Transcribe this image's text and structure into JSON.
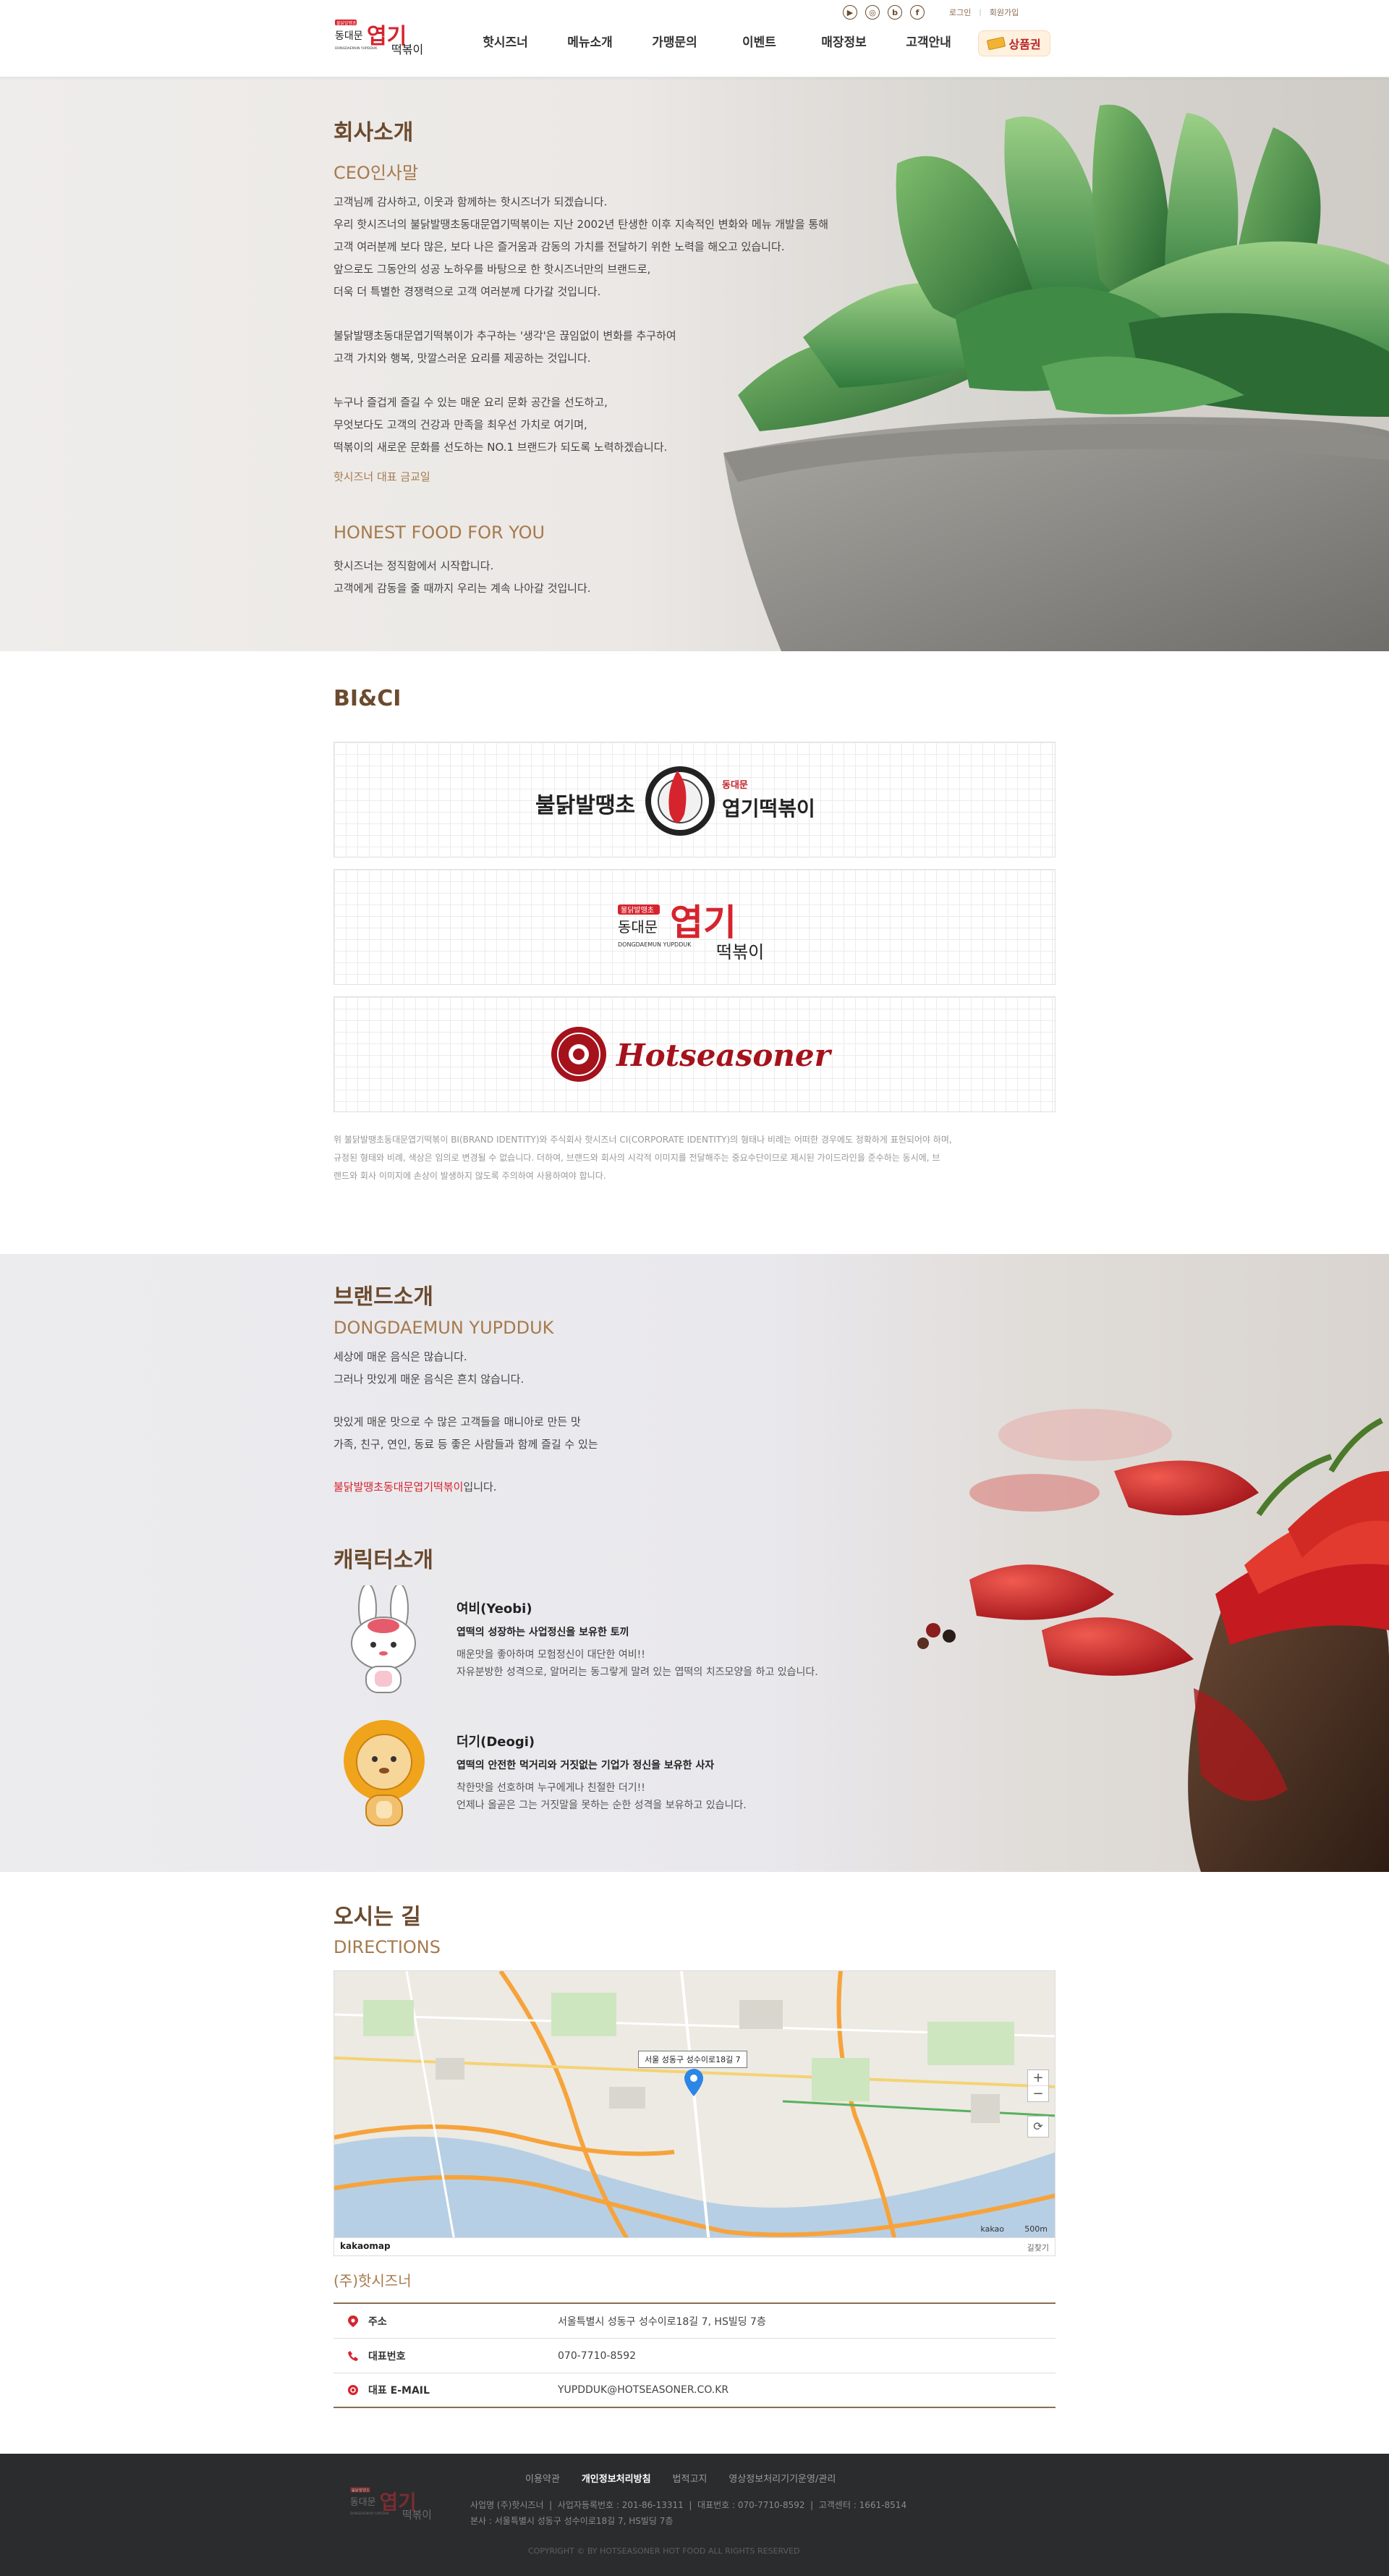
{
  "header": {
    "logo_small": "불닭발땡초",
    "logo_line1": "동대문",
    "logo_big": "엽기",
    "logo_line2": "떡볶이",
    "logo_en": "DONGDAEMUN YUPDDUK",
    "login": "로그인",
    "sep": "|",
    "join": "회원가입",
    "nav": [
      "핫시즈너",
      "메뉴소개",
      "가맹문의",
      "이벤트",
      "매장정보",
      "고객안내"
    ],
    "voucher": "상품권"
  },
  "company": {
    "title": "회사소개",
    "ceo_title": "CEO인사말",
    "paragraph1": [
      "고객님께 감사하고, 이웃과 함께하는 핫시즈너가 되겠습니다.",
      "우리 핫시즈너의 불닭발땡초동대문엽기떡볶이는 지난 2002년 탄생한 이후 지속적인 변화와 메뉴 개발을 통해",
      "고객 여러분께 보다 많은, 보다 나은 즐거움과 감동의 가치를 전달하기 위한 노력을 해오고 있습니다.",
      "앞으로도 그동안의 성공 노하우를 바탕으로 한 핫시즈너만의 브랜드로,",
      "더욱 더 특별한 경쟁력으로 고객 여러분께 다가갈 것입니다."
    ],
    "paragraph2": [
      "불닭발땡초동대문엽기떡볶이가 추구하는 '생각'은 끊임없이 변화를 추구하여",
      "고객 가치와 행복, 맛깔스러운 요리를 제공하는 것입니다."
    ],
    "paragraph3": [
      "누구나 즐겁게 즐길 수 있는 매운 요리 문화 공간을 선도하고,",
      "무엇보다도 고객의 건강과 만족을 최우선 가치로 여기며,",
      "떡볶이의 새로운 문화를 선도하는 NO.1 브랜드가 되도록 노력하겠습니다."
    ],
    "signature": "핫시즈너 대표 금교일",
    "honest_title": "HONEST FOOD FOR YOU",
    "honest_lines": [
      "핫시즈너는 정직함에서 시작합니다.",
      "고객에게 감동을 줄 때까지 우리는 계속 나아갈 것입니다."
    ]
  },
  "bi": {
    "title": "BI&CI",
    "logo1_left": "불닭발땡초",
    "logo1_right_small": "동대문",
    "logo1_right": "엽기떡볶이",
    "logo2_small": "불닭발땡초",
    "logo2_line1": "동대문",
    "logo2_big": "엽기",
    "logo2_line2": "떡볶이",
    "logo2_en": "DONGDAEMUN YUPDDUK",
    "logo3_text": "Hotseasoner",
    "note": [
      "위 불닭발땡초동대문엽기떡볶이 BI(BRAND IDENTITY)와 주식회사 핫시즈너 CI(CORPORATE IDENTITY)의 형태나 비례는 어떠한 경우에도 정확하게 표현되어야 하며,",
      "규정된 형태와 비례, 색상은 임의로 변경될 수 없습니다. 더하여, 브랜드와 회사의 시각적 이미지를 전달해주는 중요수단이므로 제시된 가이드라인을 준수하는 동시에, 브",
      "랜드와 회사 이미지에 손상이 발생하지 않도록 주의하여 사용하여야 합니다."
    ]
  },
  "brand": {
    "title": "브랜드소개",
    "sub": "DONGDAEMUN YUPDDUK",
    "lines1": [
      "세상에 매운 음식은 많습니다.",
      "그러나 맛있게 매운 음식은 흔치 않습니다."
    ],
    "lines2": [
      "맛있게 매운 맛으로 수 많은 고객들을 매니아로 만든 맛",
      "가족, 친구, 연인, 동료 등 좋은 사람들과 함께 즐길 수 있는"
    ],
    "highlight": "불닭발땡초동대문엽기떡볶이",
    "tail": "입니다.",
    "char_title": "캐릭터소개",
    "characters": [
      {
        "name": "여비(Yeobi)",
        "desc": "엽떡의 성장하는 사업정신을 보유한 토끼",
        "lines": [
          "매운맛을 좋아하며 모험정신이 대단한 여비!!",
          "자유분방한 성격으로, 알머리는 동그랗게 말려 있는 엽떡의 치즈모양을 하고 있습니다."
        ]
      },
      {
        "name": "더기(Deogi)",
        "desc": "엽떡의 안전한 먹거리와 거짓없는 기업가 정신을 보유한 사자",
        "lines": [
          "착한맛을 선호하며 누구에게나 친절한 더기!!",
          "언제나 올곧은 그는 거짓말을 못하는 순한 성격을 보유하고 있습니다."
        ]
      }
    ]
  },
  "directions": {
    "title": "오시는 길",
    "sub": "DIRECTIONS",
    "map_label": "서울 성동구 성수이로18길 7",
    "map_brand": "kakaomap",
    "map_scale": "500m",
    "map_brand_small": "kakao",
    "map_link": "길찾기",
    "company": "(주)핫시즈너",
    "rows": [
      {
        "label": "주소",
        "value": "서울특별시 성동구 성수이로18길 7, HS빌딩 7층"
      },
      {
        "label": "대표번호",
        "value": "070-7710-8592"
      },
      {
        "label": "대표 E-MAIL",
        "value": "YUPDDUK@HOTSEASONER.CO.KR"
      }
    ]
  },
  "footer": {
    "links": [
      "이용약관",
      "개인정보처리방침",
      "법적고지",
      "영상정보처리기기운영/관리"
    ],
    "info1": "사업명 (주)핫시즈너  |  사업자등록번호 : 201-86-13311  |  대표번호 : 070-7710-8592  |  고객센터 : 1661-8514",
    "info2": "본사 : 서울특별시 성동구 성수이로18길 7, HS빌딩 7층",
    "copyright": "COPYRIGHT © BY HOTSEASONER HOT FOOD ALL RIGHTS RESERVED"
  }
}
